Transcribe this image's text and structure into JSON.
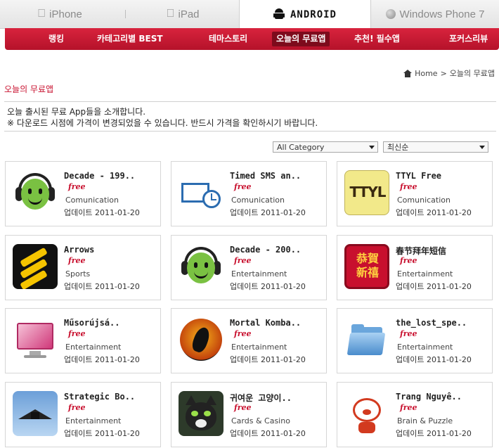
{
  "platform_tabs": [
    {
      "label": "iPhone",
      "icon": "apple-icon"
    },
    {
      "label": "iPad",
      "icon": "apple-icon"
    },
    {
      "label": "ANDROID",
      "icon": "android-icon",
      "active": true
    },
    {
      "label": "Windows Phone 7",
      "icon": "windows-icon"
    }
  ],
  "category_menu": [
    {
      "label": "랭킹"
    },
    {
      "label": "카테고리별 BEST"
    },
    {
      "label": "테마스토리"
    },
    {
      "label": "오늘의 무료앱",
      "active": true
    },
    {
      "label": "추천! 필수앱"
    },
    {
      "label": "포커스리뷰"
    }
  ],
  "breadcrumb": {
    "home": "Home",
    "separator": ">",
    "current": "오늘의 무료앱"
  },
  "page_title": "오늘의 무료앱",
  "intro": {
    "line1": "오늘 출시된 무료 App들을 소개합니다.",
    "line2": "※ 다운로드 시점에 가격이 변경되었을 수 있습니다. 반드시 가격을 확인하시기 바랍니다."
  },
  "filters": {
    "category_selected": "All Category",
    "sort_selected": "최신순"
  },
  "apps": [
    {
      "name": "Decade - 199..",
      "price": "free",
      "category": "Comunication",
      "updated": "업데이트 2011-01-20",
      "icon": "headphone-face-icon"
    },
    {
      "name": "Timed SMS an..",
      "price": "free",
      "category": "Comunication",
      "updated": "업데이트 2011-01-20",
      "icon": "envelope-clock-icon"
    },
    {
      "name": "TTYL Free",
      "price": "free",
      "category": "Comunication",
      "updated": "업데이트 2011-01-20",
      "icon": "ttyl-icon"
    },
    {
      "name": "Arrows",
      "price": "free",
      "category": "Sports",
      "updated": "업데이트 2011-01-20",
      "icon": "arrows-icon"
    },
    {
      "name": "Decade - 200..",
      "price": "free",
      "category": "Entertainment",
      "updated": "업데이트 2011-01-20",
      "icon": "headphone-face-icon"
    },
    {
      "name": "春节拜年短信",
      "price": "free",
      "category": "Entertainment",
      "updated": "업데이트 2011-01-20",
      "icon": "new-year-icon"
    },
    {
      "name": "Műsorújsá..",
      "price": "free",
      "category": "Entertainment",
      "updated": "업데이트 2011-01-20",
      "icon": "monitor-icon"
    },
    {
      "name": "Mortal Komba..",
      "price": "free",
      "category": "Entertainment",
      "updated": "업데이트 2011-01-20",
      "icon": "dragon-emblem-icon"
    },
    {
      "name": "the_lost_spe..",
      "price": "free",
      "category": "Entertainment",
      "updated": "업데이트 2011-01-20",
      "icon": "folder-icon"
    },
    {
      "name": "Strategic Bo..",
      "price": "free",
      "category": "Entertainment",
      "updated": "업데이트 2011-01-20",
      "icon": "stealth-bomber-icon"
    },
    {
      "name": "귀여운 고양이..",
      "price": "free",
      "category": "Cards & Casino",
      "updated": "업데이트 2011-01-20",
      "icon": "cat-icon"
    },
    {
      "name": "Trang Nguyê..",
      "price": "free",
      "category": "Brain & Puzzle",
      "updated": "업데이트 2011-01-20",
      "icon": "cartoon-pig-icon"
    }
  ],
  "colors": {
    "accent": "#c8102e",
    "menu_bar": "#c8192f",
    "menu_active": "#7d0b1c",
    "price": "#c8102e"
  }
}
